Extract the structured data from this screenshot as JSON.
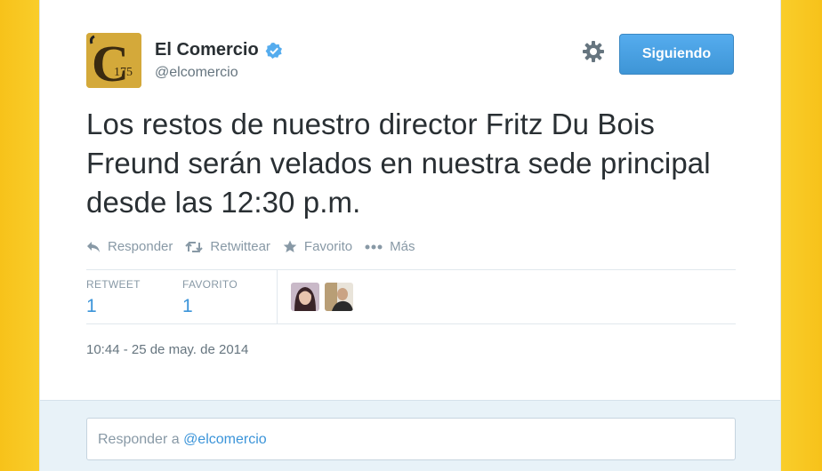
{
  "account": {
    "name": "El Comercio",
    "handle": "@elcomercio",
    "verified": true,
    "logo_text": "175"
  },
  "follow_button": {
    "label": "Siguiendo"
  },
  "tweet": {
    "text": "Los restos de nuestro director Fritz Du Bois Freund serán velados en nuestra sede principal desde las 12:30 p.m.",
    "timestamp": "10:44 - 25 de may. de 2014"
  },
  "actions": [
    {
      "label": "Responder",
      "icon": "reply-icon"
    },
    {
      "label": "Retwittear",
      "icon": "retweet-icon"
    },
    {
      "label": "Favorito",
      "icon": "star-icon"
    },
    {
      "label": "Más",
      "icon": "more-icon"
    }
  ],
  "stats": {
    "retweets": {
      "label": "RETWEET",
      "value": "1"
    },
    "favorites": {
      "label": "FAVORITO",
      "value": "1"
    }
  },
  "reply": {
    "prefix": "Responder a ",
    "mention": "@elcomercio"
  },
  "colors": {
    "background": "#f9cd2a",
    "accent": "#3b94d9",
    "button": "#4aa3df"
  }
}
